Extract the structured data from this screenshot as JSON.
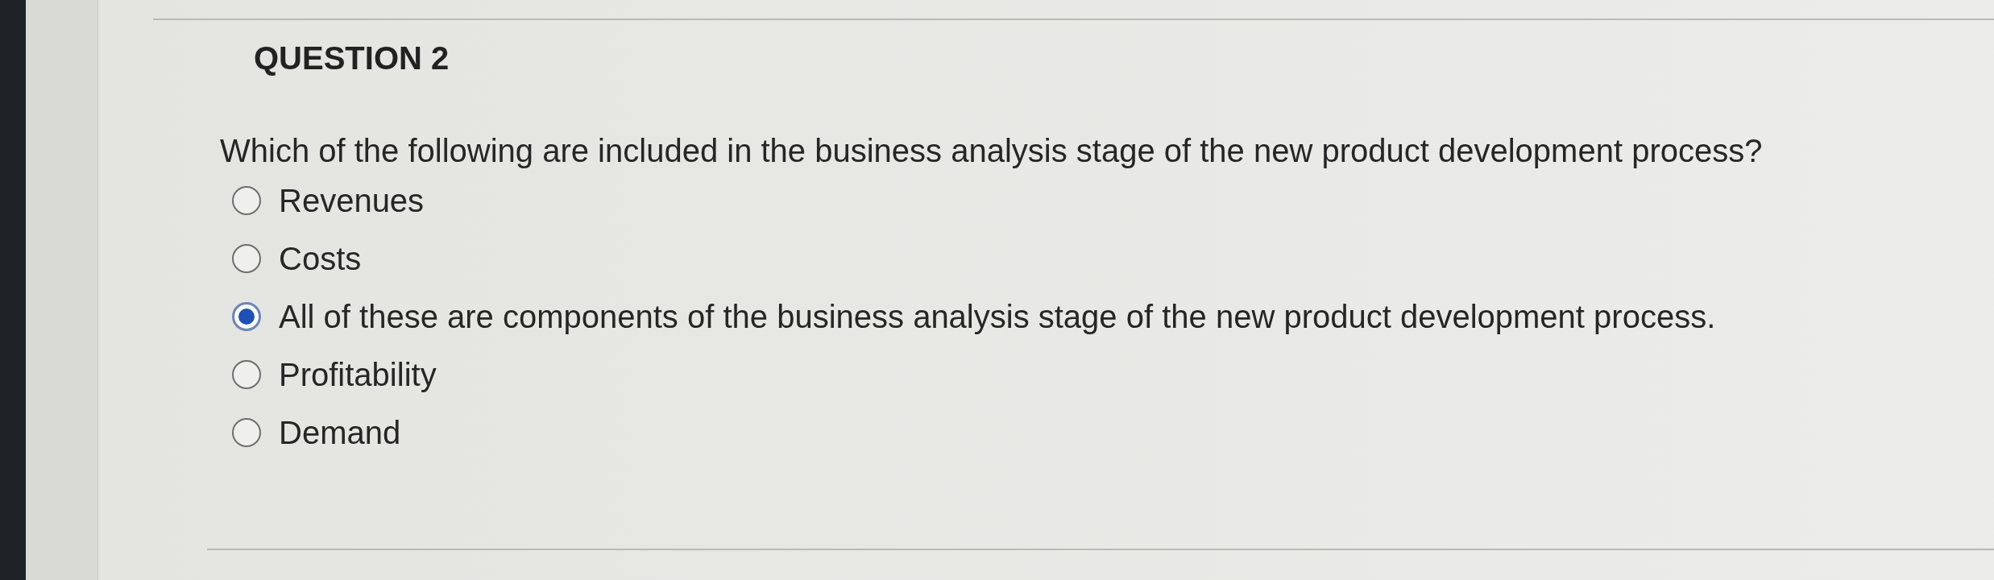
{
  "question": {
    "title": "QUESTION 2",
    "prompt": "Which of the following are included in the business analysis stage of the new product development process?",
    "options": [
      {
        "label": "Revenues",
        "selected": false
      },
      {
        "label": "Costs",
        "selected": false
      },
      {
        "label": "All of these are components of the business analysis stage of the new product development process.",
        "selected": true
      },
      {
        "label": "Profitability",
        "selected": false
      },
      {
        "label": "Demand",
        "selected": false
      }
    ]
  }
}
